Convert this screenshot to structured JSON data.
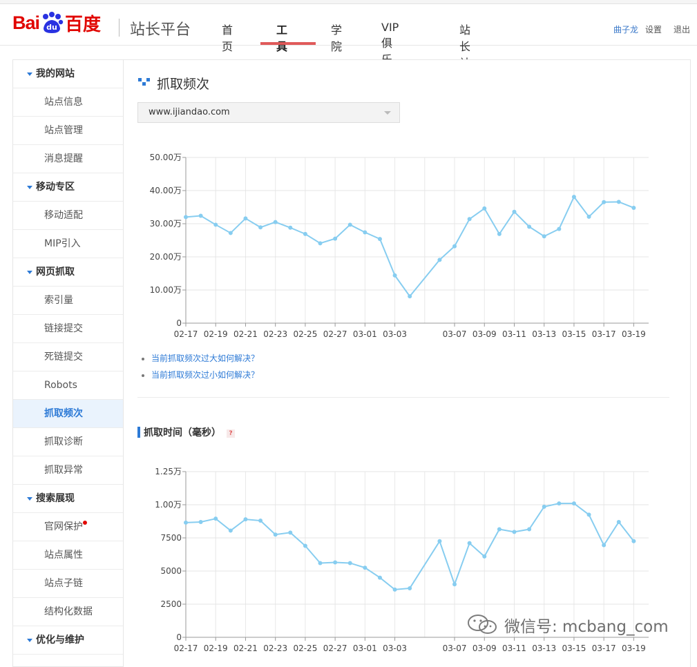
{
  "header": {
    "logo": {
      "latin": "Bai",
      "du": "du",
      "chinese": "百度"
    },
    "platform": "站长平台",
    "nav": [
      "首页",
      "工具",
      "学院",
      "VIP俱乐部",
      "站长社区"
    ],
    "active_nav": "工具",
    "user": {
      "name": "曲子龙",
      "settings": "设置",
      "logout": "退出"
    }
  },
  "sidebar": {
    "groups": [
      {
        "label": "我的网站",
        "items": [
          "站点信息",
          "站点管理",
          "消息提醒"
        ]
      },
      {
        "label": "移动专区",
        "items": [
          "移动适配",
          "MIP引入"
        ]
      },
      {
        "label": "网页抓取",
        "items": [
          "索引量",
          "链接提交",
          "死链提交",
          "Robots",
          "抓取频次",
          "抓取诊断",
          "抓取异常"
        ]
      },
      {
        "label": "搜索展现",
        "items": [
          "官网保护",
          "站点属性",
          "站点子链",
          "结构化数据"
        ]
      },
      {
        "label": "优化与维护",
        "items": []
      }
    ],
    "active_item": "抓取频次",
    "badge_item": "官网保护"
  },
  "main": {
    "title": "抓取频次",
    "site_select": {
      "value": "www.ijiandao.com"
    },
    "help_links": [
      "当前抓取频次过大如何解决？",
      "当前抓取频次过小如何解决？"
    ],
    "sub_title": "抓取时间（毫秒）",
    "help_badge": "?"
  },
  "watermark": "微信号: mcbang_com",
  "colors": {
    "line": "#87cdf0",
    "accent": "#2d7ad6",
    "brand": "#e10602"
  },
  "chart_data": [
    {
      "type": "line",
      "x": [
        "02-17",
        "02-18",
        "02-19",
        "02-20",
        "02-21",
        "02-22",
        "02-23",
        "02-24",
        "02-25",
        "02-26",
        "02-27",
        "02-28",
        "03-01",
        "03-02",
        "03-03",
        "03-04",
        "03-05",
        "03-06",
        "03-07",
        "03-08",
        "03-09",
        "03-10",
        "03-11",
        "03-12",
        "03-13",
        "03-14",
        "03-15",
        "03-16",
        "03-17",
        "03-18",
        "03-19",
        "03-20"
      ],
      "values": [
        32.0,
        32.4,
        29.7,
        27.2,
        31.6,
        28.9,
        30.5,
        28.8,
        26.9,
        24.1,
        25.5,
        29.7,
        27.4,
        25.4,
        14.4,
        8.1,
        19.1,
        23.2,
        31.4,
        34.6,
        26.9,
        33.6,
        29.1,
        26.2,
        28.4,
        38.1,
        32.1,
        36.5,
        36.6,
        34.8
      ],
      "tick_labels": [
        "02-17",
        "02-19",
        "02-21",
        "02-23",
        "02-25",
        "02-27",
        "03-01",
        "03-03",
        "03-07",
        "03-09",
        "03-11",
        "03-13",
        "03-15",
        "03-17",
        "03-19"
      ],
      "y_ticks": [
        "0",
        "10.00万",
        "20.00万",
        "30.00万",
        "40.00万",
        "50.00万"
      ],
      "ylim": [
        0,
        50
      ],
      "grid": true
    },
    {
      "type": "line",
      "x": [
        "02-17",
        "02-18",
        "02-19",
        "02-20",
        "02-21",
        "02-22",
        "02-23",
        "02-24",
        "02-25",
        "02-26",
        "02-27",
        "02-28",
        "03-01",
        "03-02",
        "03-03",
        "03-04",
        "03-05",
        "03-06",
        "03-07",
        "03-08",
        "03-09",
        "03-10",
        "03-11",
        "03-12",
        "03-13",
        "03-14",
        "03-15",
        "03-16",
        "03-17",
        "03-18",
        "03-19",
        "03-20"
      ],
      "values": [
        8650,
        8700,
        8950,
        8050,
        8900,
        8800,
        7750,
        7900,
        6900,
        5600,
        5650,
        5600,
        5250,
        4500,
        3600,
        3700,
        7250,
        4000,
        7100,
        6100,
        8150,
        7950,
        8150,
        9850,
        10100,
        10100,
        9250,
        6950,
        8700,
        7250
      ],
      "tick_labels": [
        "02-17",
        "02-19",
        "02-21",
        "02-23",
        "02-25",
        "02-27",
        "03-01",
        "03-03",
        "03-07",
        "03-09",
        "03-11",
        "03-13",
        "03-15",
        "03-17",
        "03-19"
      ],
      "y_ticks": [
        "0",
        "2500",
        "5000",
        "7500",
        "1.00万",
        "1.25万"
      ],
      "ylim": [
        0,
        12500
      ],
      "grid": true
    }
  ]
}
